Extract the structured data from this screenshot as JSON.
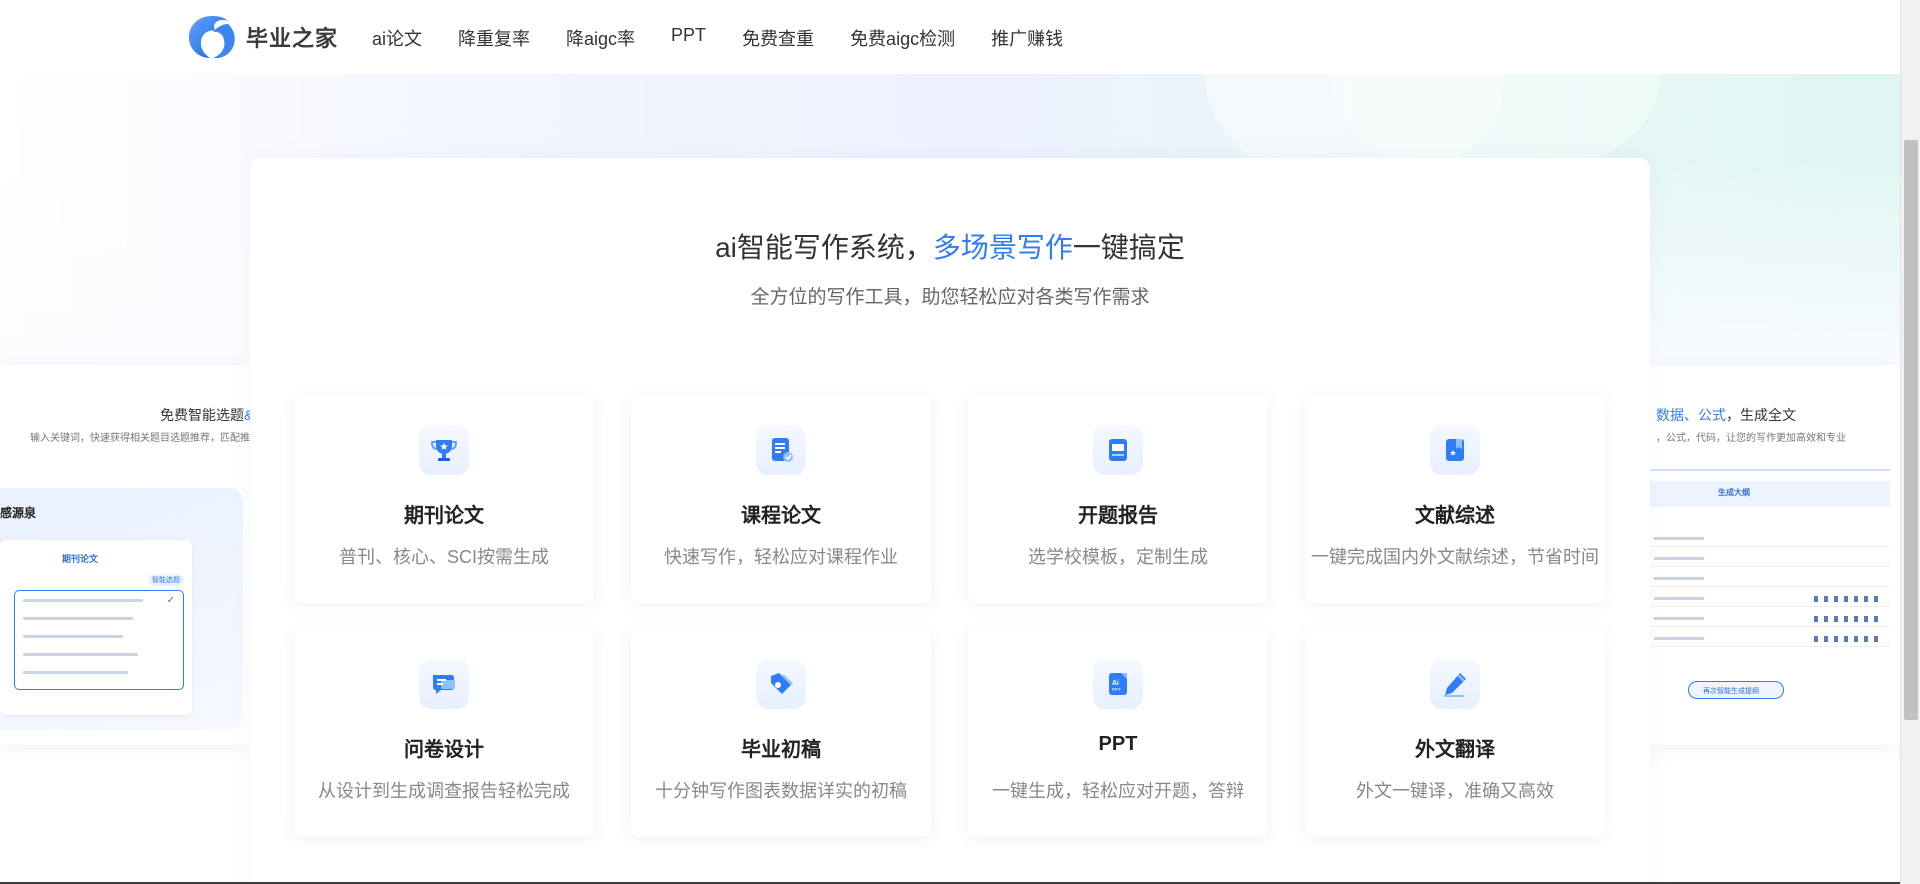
{
  "brand": {
    "name": "毕业之家"
  },
  "nav": {
    "items": [
      {
        "label": "ai论文"
      },
      {
        "label": "降重复率"
      },
      {
        "label": "降aigc率"
      },
      {
        "label": "PPT"
      },
      {
        "label": "免费查重"
      },
      {
        "label": "免费aigc检测"
      },
      {
        "label": "推广赚钱"
      }
    ]
  },
  "hero": {
    "title_prefix": "ai智能写作系统，",
    "title_highlight": "多场景写作",
    "title_suffix": "一键搞定",
    "subtitle": "全方位的写作工具，助您轻松应对各类写作需求"
  },
  "features": [
    {
      "title": "期刊论文",
      "desc": "普刊、核心、SCI按需生成",
      "icon": "trophy-icon"
    },
    {
      "title": "课程论文",
      "desc": "快速写作，轻松应对课程作业",
      "icon": "document-icon"
    },
    {
      "title": "开题报告",
      "desc": "选学校模板，定制生成",
      "icon": "report-icon"
    },
    {
      "title": "文献综述",
      "desc": "一键完成国内外文献综述，节省时间",
      "icon": "bookmark-icon"
    },
    {
      "title": "问卷设计",
      "desc": "从设计到生成调查报告轻松完成",
      "icon": "chat-icon"
    },
    {
      "title": "毕业初稿",
      "desc": "十分钟写作图表数据详实的初稿",
      "icon": "tag-icon"
    },
    {
      "title": "PPT",
      "desc": "一键生成，轻松应对开题，答辩",
      "icon": "ai-ppt-icon"
    },
    {
      "title": "外文翻译",
      "desc": "外文一键译，准确又高效",
      "icon": "pen-icon"
    }
  ],
  "side_left": {
    "title": "免费智能选题",
    "title_highlight": "&",
    "subtitle": "输入关键词，快速获得相关题目选题推荐，匹配推",
    "panel_title": "感源泉",
    "inner_head": "期刊论文",
    "tag": "智能选题"
  },
  "side_right": {
    "title_highlight_1": "数据",
    "title_sep_1": "、",
    "title_highlight_2": "公式",
    "title_suffix": "，生成全文",
    "subtitle": "，公式，代码，让您的写作更加高效和专业",
    "band_text": "生成大纲",
    "button_text": "再次智能生成提纲"
  },
  "colors": {
    "accent": "#2f7cf6",
    "text": "#333333",
    "muted": "#888888"
  }
}
